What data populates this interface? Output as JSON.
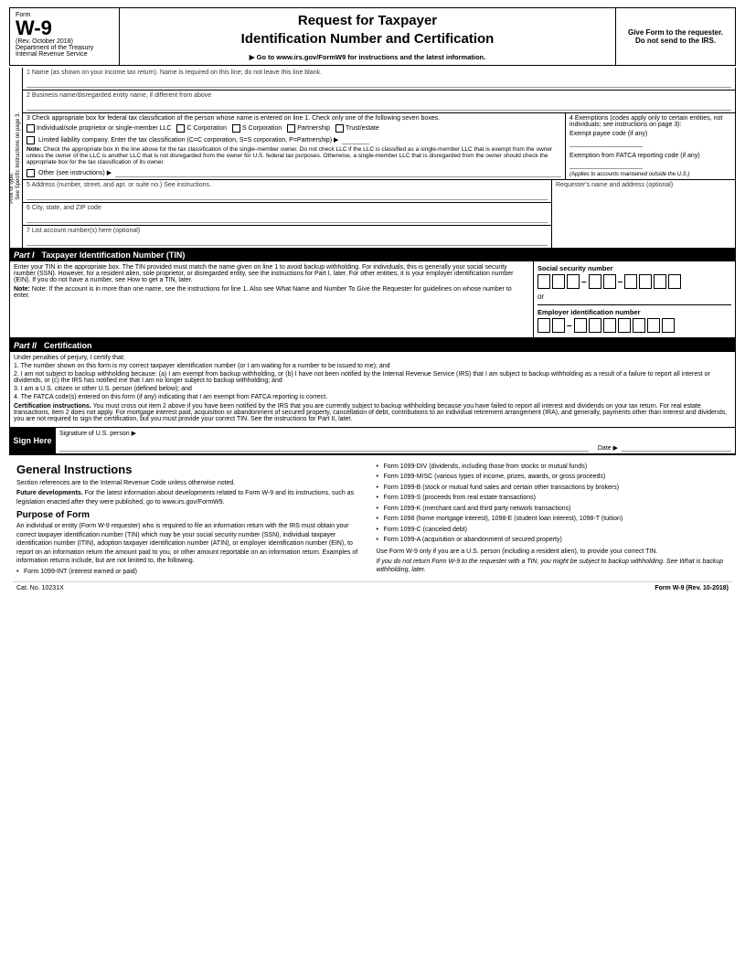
{
  "header": {
    "form_label": "Form",
    "form_number": "W-9",
    "rev_date": "(Rev. October 2018)",
    "dept": "Department of the Treasury",
    "irs": "Internal Revenue Service",
    "title_line1": "Request for Taxpayer",
    "title_line2": "Identification Number and Certification",
    "go_to": "▶ Go to www.irs.gov/FormW9 for instructions and the latest information.",
    "give_form": "Give Form to the requester. Do not send to the IRS."
  },
  "fields": {
    "line1_label": "1  Name (as shown on your income tax return). Name is required on this line; do not leave this line blank.",
    "line2_label": "2  Business name/disregarded entity name, if different from above",
    "line3_label": "3  Check appropriate box for federal tax classification of the person whose name is entered on line 1. Check only one of the following seven boxes.",
    "checkbox_individual": "Individual/sole proprietor or single-member LLC",
    "checkbox_c_corp": "C Corporation",
    "checkbox_s_corp": "S Corporation",
    "checkbox_partnership": "Partnership",
    "checkbox_trust": "Trust/estate",
    "llc_label": "Limited liability company. Enter the tax classification (C=C corporation, S=S corporation, P=Partnership) ▶",
    "llc_input_placeholder": "",
    "note_label": "Note:",
    "note_text": "Check the appropriate box in the line above for the tax classification of the single-member owner. Do not check LLC if the LLC is classified as a single-member LLC that is exempt from the owner unless the owner of the LLC is another LLC that is not disregarded from the owner for U.S. federal tax purposes. Otherwise, a single-member LLC that is disregarded from the owner should check the appropriate box for the tax classification of its owner.",
    "other_label": "Other (see instructions) ▶",
    "line4_label": "4  Exemptions (codes apply only to certain entities, not individuals; see instructions on page 3):",
    "exempt_payee_label": "Exempt payee code (if any)",
    "fatca_label": "Exemption from FATCA reporting code (if any)",
    "fatca_note": "(Applies to accounts maintained outside the U.S.)",
    "line5_label": "5  Address (number, street, and apt. or suite no.) See instructions.",
    "line5_right_label": "Requester's name and address (optional)",
    "line6_label": "6  City, state, and ZIP code",
    "line7_label": "7  List account number(s) here (optional)",
    "sidebar_print": "Print or type.",
    "sidebar_see": "See Specific Instructions on page 3."
  },
  "part1": {
    "number": "Part I",
    "title": "Taxpayer Identification Number (TIN)",
    "body_text": "Enter your TIN in the appropriate box. The TIN provided must match the name given on line 1 to avoid backup withholding. For individuals, this is generally your social security number (SSN). However, for a resident alien, sole proprietor, or disregarded entity, see the instructions for Part I, later. For other entities, it is your employer identification number (EIN). If you do not have a number, see How to get a TIN, later.",
    "note_text": "Note: If the account is in more than one name, see the instructions for line 1. Also see What Name and Number To Give the Requester for guidelines on whose number to enter.",
    "ssn_label": "Social security number",
    "or_label": "or",
    "ein_label": "Employer identification number"
  },
  "part2": {
    "number": "Part II",
    "title": "Certification",
    "under_penalties": "Under penalties of perjury, I certify that:",
    "item1": "1. The number shown on this form is my correct taxpayer identification number (or I am waiting for a number to be issued to me); and",
    "item2": "2. I am not subject to backup withholding because: (a) I am exempt from backup withholding, or (b) I have not been notified by the Internal Revenue Service (IRS) that I am subject to backup withholding as a result of a failure to report all interest or dividends, or (c) the IRS has notified me that I am no longer subject to backup withholding; and",
    "item3": "3. I am a U.S. citizen or other U.S. person (defined below); and",
    "item4": "4. The FATCA code(s) entered on this form (if any) indicating that I am exempt from FATCA reporting is correct.",
    "cert_instructions_label": "Certification instructions.",
    "cert_instructions_text": "You must cross out item 2 above if you have been notified by the IRS that you are currently subject to backup withholding because you have failed to report all interest and dividends on your tax return. For real estate transactions, item 2 does not apply. For mortgage interest paid, acquisition or abandonment of secured property, cancellation of debt, contributions to an individual retirement arrangement (IRA), and generally, payments other than interest and dividends, you are not required to sign the certification, but you must provide your correct TIN. See the instructions for Part II, later."
  },
  "sign": {
    "sign_here_label": "Sign Here",
    "signature_label": "Signature of",
    "us_person_label": "U.S. person ▶",
    "date_label": "Date ▶"
  },
  "general_instructions": {
    "title": "General Instructions",
    "section_refs": "Section references are to the Internal Revenue Code unless otherwise noted.",
    "future_dev_label": "Future developments.",
    "future_dev_text": "For the latest information about developments related to Form W-9 and its instructions, such as legislation enacted after they were published, go to www.irs.gov/FormW9.",
    "purpose_title": "Purpose of Form",
    "purpose_text": "An individual or entity (Form W-9 requester) who is required to file an information return with the IRS must obtain your correct taxpayer identification number (TIN) which may be your social security number (SSN), individual taxpayer identification number (ITIN), adoption taxpayer identification number (ATIN), or employer identification number (EIN), to report on an information return the amount paid to you, or other amount reportable on an information return. Examples of information returns include, but are not limited to, the following.",
    "bullet1": "Form 1099-INT (interest earned or paid)",
    "right_bullets": [
      "Form 1099-DIV (dividends, including those from stocks or mutual funds)",
      "Form 1099-MISC (various types of income, prizes, awards, or gross proceeds)",
      "Form 1099-B (stock or mutual fund sales and certain other transactions by brokers)",
      "Form 1099-S (proceeds from real estate transactions)",
      "Form 1099-K (merchant card and third party network transactions)",
      "Form 1098 (home mortgage interest), 1098-E (student loan interest), 1098-T (tuition)",
      "Form 1099-C (canceled debt)",
      "Form 1099-A (acquisition or abandonment of secured property)"
    ],
    "use_w9_text": "Use Form W-9 only if you are a U.S. person (including a resident alien), to provide your correct TIN.",
    "italic_note": "If you do not return Form W-9 to the requester with a TIN, you might be subject to backup withholding. See What is backup withholding, later."
  },
  "footer": {
    "cat_no": "Cat. No. 10231X",
    "form_label": "Form W-9 (Rev. 10-2018)"
  }
}
